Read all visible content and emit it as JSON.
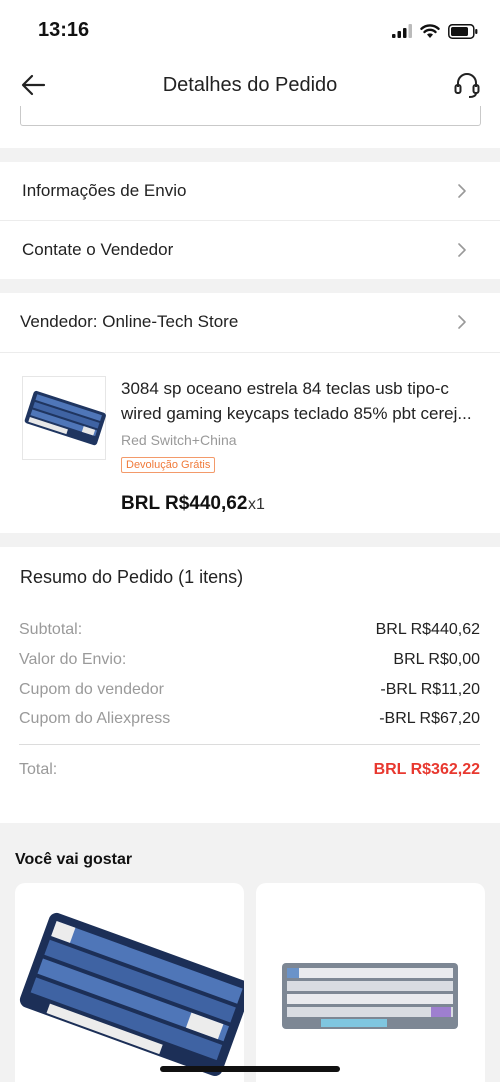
{
  "status": {
    "time": "13:16"
  },
  "nav": {
    "title": "Detalhes do Pedido"
  },
  "links": [
    {
      "label": "Informações de Envio"
    },
    {
      "label": "Contate o Vendedor"
    }
  ],
  "seller": {
    "label": "Vendedor: Online-Tech Store"
  },
  "product": {
    "title_line1": "3084 sp oceano estrela 84 teclas usb tipo-c",
    "title_line2": "wired gaming keycaps teclado 85% pbt cerej...",
    "variant": "Red Switch+China",
    "badge": "Devolução Grátis",
    "price": "BRL R$440,62",
    "quantity": "x1"
  },
  "summary": {
    "title": "Resumo do Pedido (1 itens)",
    "rows": [
      {
        "label": "Subtotal:",
        "value": "BRL R$440,62"
      },
      {
        "label": "Valor do Envio:",
        "value": "BRL R$0,00"
      },
      {
        "label": "Cupom do vendedor",
        "value": "-BRL R$11,20"
      },
      {
        "label": "Cupom do Aliexpress",
        "value": "-BRL R$67,20"
      }
    ],
    "total_label": "Total:",
    "total_value": "BRL R$362,22"
  },
  "recommendations": {
    "title": "Você vai gostar"
  },
  "colors": {
    "total_red": "#e8382f",
    "badge_orange": "#f07a3a",
    "background": "#f2f2f2"
  }
}
